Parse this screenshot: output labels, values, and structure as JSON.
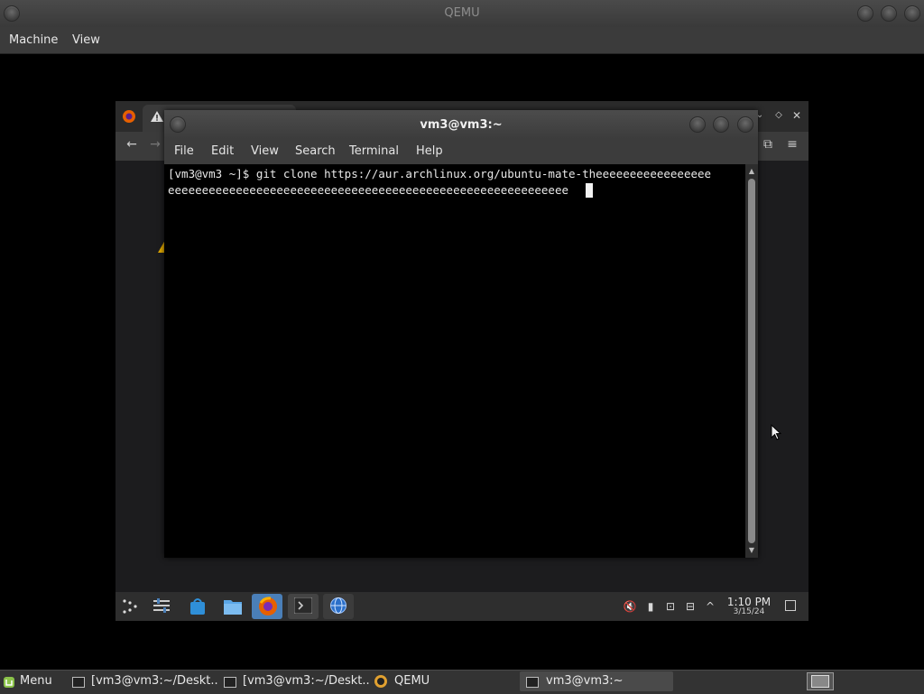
{
  "qemu": {
    "title": "QEMU",
    "menu": [
      "Machine",
      "View"
    ]
  },
  "terminal": {
    "title": "vm3@vm3:~",
    "menu": [
      "File",
      "Edit",
      "View",
      "Search",
      "Terminal",
      "Help"
    ],
    "lines": [
      "[vm3@vm3 ~]$ git clone https://aur.archlinux.org/ubuntu-mate-theeeeeeeeeeeeeeeee",
      "eeeeeeeeeeeeeeeeeeeeeeeeeeeeeeeeeeeeeeeeeeeeeeeeeeeeeeeeeee"
    ]
  },
  "guest_panel": {
    "clock_time": "1:10 PM",
    "clock_date": "3/15/24"
  },
  "host_taskbar": {
    "menu_label": "Menu",
    "tasks": [
      "[vm3@vm3:~/Deskt...",
      "[vm3@vm3:~/Deskt...",
      "QEMU",
      "vm3@vm3:~"
    ]
  },
  "colors": {
    "panel_accent": "#4a7fb8",
    "firefox_orange": "#e66000",
    "terminal_bg": "#000000"
  }
}
